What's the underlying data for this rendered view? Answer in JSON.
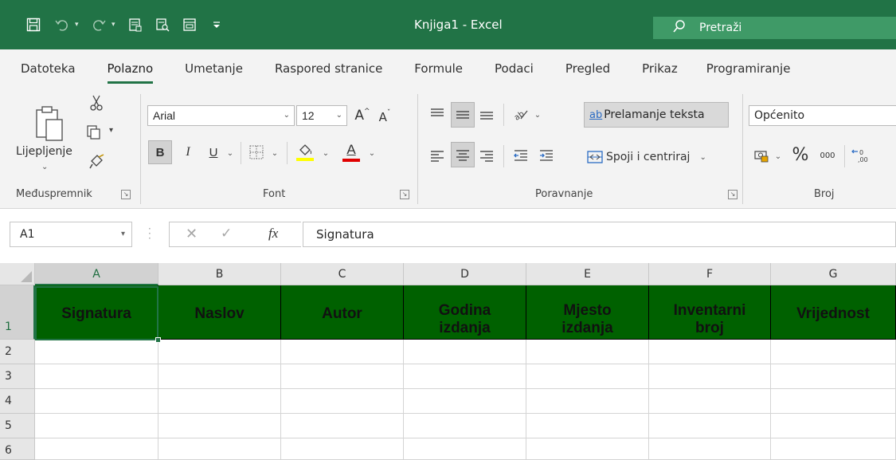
{
  "window": {
    "title": "Knjiga1  -  Excel",
    "search_label": "Pretraži"
  },
  "tabs": [
    "Datoteka",
    "Polazno",
    "Umetanje",
    "Raspored stranice",
    "Formule",
    "Podaci",
    "Pregled",
    "Prikaz",
    "Programiranje"
  ],
  "active_tab": "Polazno",
  "ribbon": {
    "clipboard": {
      "paste_label": "Lijepljenje",
      "group_label": "Međuspremnik"
    },
    "font": {
      "font_name": "Arial",
      "font_size": "12",
      "bold": "B",
      "italic": "I",
      "underline": "U",
      "group_label": "Font",
      "grow": "A",
      "shrink": "A",
      "color_glyph": "A"
    },
    "alignment": {
      "wrap_text": "Prelamanje teksta",
      "merge_center": "Spoji i centriraj",
      "group_label": "Poravnanje",
      "wrap_glyph": "ab"
    },
    "number": {
      "format": "Općenito",
      "percent": "%",
      "thousands": "000",
      "group_label": "Broj"
    },
    "colors": {
      "fill_highlight": "#ffff00",
      "font_color": "#e00000"
    }
  },
  "formula_bar": {
    "name_box": "A1",
    "fx": "fx",
    "content": "Signatura"
  },
  "sheet": {
    "columns": [
      "A",
      "B",
      "C",
      "D",
      "E",
      "F",
      "G"
    ],
    "rows": [
      "1",
      "2",
      "3",
      "4",
      "5",
      "6"
    ],
    "header_cells": {
      "A": "Signatura",
      "B": "Naslov",
      "C": "Autor",
      "D": "Godina izdanja",
      "E": "Mjesto izdanja",
      "F": "Inventarni broj",
      "G": "Vrijednost"
    },
    "header_fill": "#006100",
    "active_cell": "A1"
  }
}
